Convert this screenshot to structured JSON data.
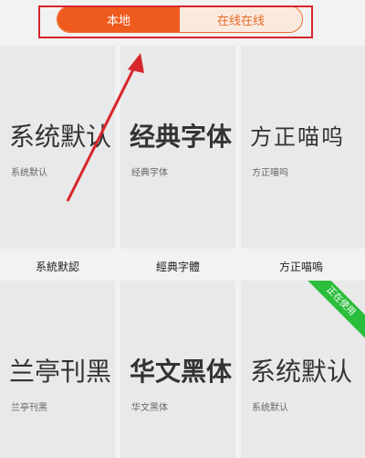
{
  "tabs": {
    "local": "本地",
    "online": "在线在线"
  },
  "fonts": [
    {
      "preview": "系统默认",
      "sub": "系统默认",
      "label": "系統默認"
    },
    {
      "preview": "经典字体",
      "sub": "经典字体",
      "label": "經典字體"
    },
    {
      "preview": "方正喵呜",
      "sub": "方正喵呜",
      "label": "方正喵嗚"
    },
    {
      "preview": "兰亭刊黑",
      "sub": "兰亭刊黑",
      "label": ""
    },
    {
      "preview": "华文黑体",
      "sub": "华文黑体",
      "label": ""
    },
    {
      "preview": "系统默认",
      "sub": "系统默认",
      "label": ""
    }
  ],
  "badge": "正在使用",
  "colors": {
    "accent": "#ef5b1e",
    "badge": "#2bbd3c",
    "annotation": "#d6262b"
  }
}
